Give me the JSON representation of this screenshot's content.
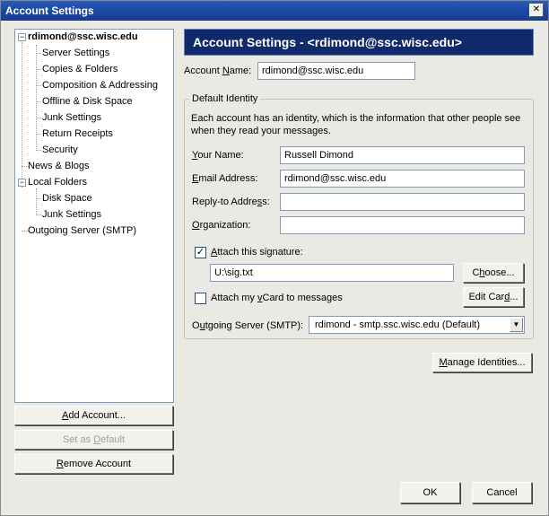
{
  "window": {
    "title": "Account Settings",
    "close_glyph": "✕"
  },
  "tree": {
    "items": [
      {
        "label": "rdimond@ssc.wisc.edu"
      },
      {
        "label": "Server Settings"
      },
      {
        "label": "Copies & Folders"
      },
      {
        "label": "Composition & Addressing"
      },
      {
        "label": "Offline & Disk Space"
      },
      {
        "label": "Junk Settings"
      },
      {
        "label": "Return Receipts"
      },
      {
        "label": "Security"
      },
      {
        "label": "News & Blogs"
      },
      {
        "label": "Local Folders"
      },
      {
        "label": "Disk Space"
      },
      {
        "label": "Junk Settings"
      },
      {
        "label": "Outgoing Server (SMTP)"
      }
    ],
    "expander_glyph": "−"
  },
  "buttons": {
    "add_account_pre": "",
    "add_account_u": "A",
    "add_account_post": "dd Account...",
    "set_default_pre": "Set as ",
    "set_default_u": "D",
    "set_default_post": "efault",
    "remove_pre": "",
    "remove_u": "R",
    "remove_post": "emove Account",
    "choose_pre": "C",
    "choose_u": "h",
    "choose_post": "oose...",
    "edit_card_pre": "Edit Car",
    "edit_card_u": "d",
    "edit_card_post": "...",
    "manage_pre": "",
    "manage_u": "M",
    "manage_post": "anage Identities...",
    "ok": "OK",
    "cancel": "Cancel"
  },
  "main": {
    "header": "Account Settings - <rdimond@ssc.wisc.edu>",
    "account_name_pre": "Account ",
    "account_name_u": "N",
    "account_name_post": "ame:",
    "account_name_value": "rdimond@ssc.wisc.edu",
    "group_title": "Default Identity",
    "description": "Each account has an identity, which is the information that other people see when they read your messages.",
    "your_name_pre": "",
    "your_name_u": "Y",
    "your_name_post": "our Name:",
    "your_name_value": "Russell Dimond",
    "email_pre": "",
    "email_u": "E",
    "email_post": "mail Address:",
    "email_value": "rdimond@ssc.wisc.edu",
    "reply_pre": "Reply-to Addre",
    "reply_u": "s",
    "reply_post": "s:",
    "reply_value": "",
    "org_pre": "",
    "org_u": "O",
    "org_post": "rganization:",
    "org_value": "",
    "attach_sig_pre": "",
    "attach_sig_u": "A",
    "attach_sig_post": "ttach this signature:",
    "attach_sig_checked": "✓",
    "sig_path": "U:\\sig.txt",
    "vcard_pre": "Attach my ",
    "vcard_u": "v",
    "vcard_post": "Card to messages",
    "smtp_pre": "O",
    "smtp_u": "u",
    "smtp_post": "tgoing Server (SMTP):",
    "smtp_value": "rdimond - smtp.ssc.wisc.edu (Default)",
    "dropdown_glyph": "▼"
  }
}
